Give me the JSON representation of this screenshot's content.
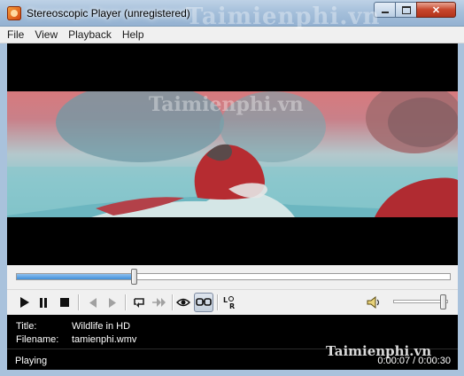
{
  "window": {
    "title": "Stereoscopic Player (unregistered)"
  },
  "menu": [
    "File",
    "View",
    "Playback",
    "Help"
  ],
  "video": {
    "watermark": "Taimienphi.vn"
  },
  "seek": {
    "progress": 0.27
  },
  "controls": {
    "icons": [
      "play-icon",
      "pause-icon",
      "stop-icon",
      "previous-icon",
      "next-icon",
      "loop-icon",
      "skip-icon",
      "view-icon",
      "stereo-glasses-icon",
      "left-right-icon",
      "speaker-icon"
    ]
  },
  "volume": {
    "level": 0.92
  },
  "info": {
    "title_label": "Title:",
    "title_value": "Wildlife in HD",
    "filename_label": "Filename:",
    "filename_value": "tamienphi.wmv"
  },
  "status": {
    "state": "Playing",
    "time": "0:00:07 / 0:00:30"
  },
  "watermark": "Taimienphi.vn",
  "colors": {
    "seek_fill": "#3f8fd9",
    "close_button": "#c7462c",
    "titlebar": "#a6c0db"
  }
}
